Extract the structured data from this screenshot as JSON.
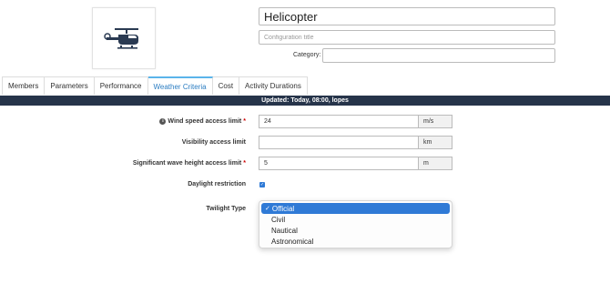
{
  "header": {
    "title_value": "Helicopter",
    "config_title_placeholder": "Configuration title",
    "category_label": "Category:",
    "category_value": "",
    "logo_icon": "helicopter-icon"
  },
  "tabs": [
    {
      "label": "Members"
    },
    {
      "label": "Parameters"
    },
    {
      "label": "Performance"
    },
    {
      "label": "Weather Criteria",
      "active": true
    },
    {
      "label": "Cost"
    },
    {
      "label": "Activity Durations"
    }
  ],
  "status": {
    "text": "Updated: Today, 08:00, lopes"
  },
  "form": {
    "wind": {
      "label": "Wind speed access limit",
      "required": "*",
      "value": "24",
      "unit": "m/s",
      "icon": "info-icon"
    },
    "visibility": {
      "label": "Visibility access limit",
      "value": "",
      "unit": "km"
    },
    "wave": {
      "label": "Significant wave height access limit",
      "required": "*",
      "value": "5",
      "unit": "m"
    },
    "daylight": {
      "label": "Daylight restriction",
      "checked": true
    },
    "twilight": {
      "label": "Twilight Type",
      "options": [
        "Official",
        "Civil",
        "Nautical",
        "Astronomical"
      ],
      "selected": "Official"
    }
  },
  "colors": {
    "accent": "#2f7ad6",
    "status_bar": "#26344a",
    "active_tab_text": "#2b7dc2",
    "required": "#cc0000"
  }
}
